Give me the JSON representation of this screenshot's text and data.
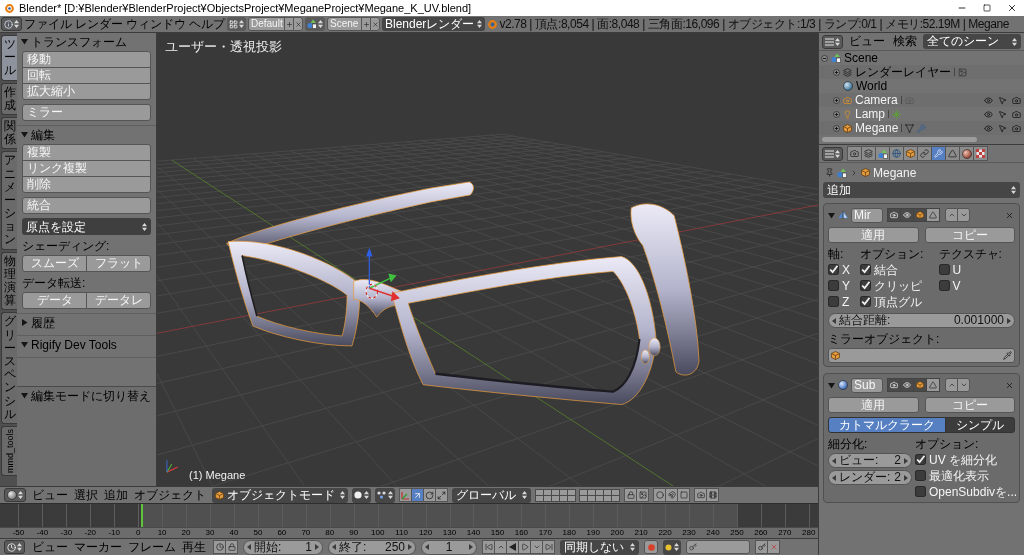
{
  "window": {
    "title": "Blender* [D:¥Blender¥BlenderProject¥ObjectsProject¥MeganeProject¥Megane_K_UV.blend]"
  },
  "info_header": {
    "menus": [
      "ファイル",
      "レンダー",
      "ウィンドウ",
      "ヘルプ"
    ],
    "screen_layout": "Default",
    "scene": "Scene",
    "render_engine": "Blenderレンダー",
    "stats": "v2.78 | 頂点:8,054 | 面:8,048 | 三角面:16,096 | オブジェクト:1/3 | ランプ:0/1 | メモリ:52.19M | Megane"
  },
  "tool_shelf": {
    "tabs": [
      {
        "label": "ツール",
        "kind": "stacked",
        "selected": true
      },
      {
        "label": "作成",
        "kind": "stacked",
        "selected": false
      },
      {
        "label": "関係",
        "kind": "stacked",
        "selected": false
      },
      {
        "label": "アニメーション",
        "kind": "stacked",
        "selected": false
      },
      {
        "label": "物理演算",
        "kind": "stacked",
        "selected": false
      },
      {
        "label": "グリースペンシル",
        "kind": "stacked",
        "selected": false
      },
      {
        "label": "mmd_tools",
        "kind": "rotated",
        "selected": false
      }
    ],
    "panels": [
      {
        "title": "トランスフォーム",
        "expanded": true,
        "rows": [
          {
            "kind": "stack",
            "buttons": [
              "移動",
              "回転",
              "拡大縮小"
            ]
          },
          {
            "kind": "stack",
            "buttons": [
              "ミラー"
            ]
          }
        ]
      },
      {
        "title": "編集",
        "expanded": true,
        "rows": [
          {
            "kind": "stack",
            "buttons": [
              "複製",
              "リンク複製",
              "削除"
            ]
          },
          {
            "kind": "stack",
            "buttons": [
              "統合"
            ]
          },
          {
            "kind": "dropdown",
            "value": "原点を設定"
          },
          {
            "kind": "label",
            "text": "シェーディング:"
          },
          {
            "kind": "pair",
            "buttons": [
              "スムーズ",
              "フラット"
            ]
          },
          {
            "kind": "label",
            "text": "データ転送:"
          },
          {
            "kind": "pair",
            "buttons": [
              "データ",
              "データレ"
            ]
          }
        ]
      },
      {
        "title": "履歴",
        "expanded": false
      },
      {
        "title": "Rigify Dev Tools",
        "expanded": true
      }
    ],
    "last_operator": {
      "title": "編集モードに切り替え",
      "expanded": true
    }
  },
  "viewport": {
    "view_name": "ユーザー・透視投影",
    "object_info": "(1) Megane"
  },
  "viewport_header": {
    "menus": [
      "ビュー",
      "選択",
      "追加",
      "オブジェクト"
    ],
    "mode": "オブジェクトモード",
    "manipulators": [
      {
        "kind": "translate",
        "selected": true
      },
      {
        "kind": "rotate",
        "selected": false
      },
      {
        "kind": "scale",
        "selected": false
      }
    ],
    "orientation": "グローバル"
  },
  "timeline": {
    "ruler": [
      "-50",
      "-40",
      "-30",
      "-20",
      "-10",
      "0",
      "10",
      "20",
      "30",
      "40",
      "50",
      "60",
      "70",
      "80",
      "90",
      "100",
      "110",
      "120",
      "130",
      "140",
      "150",
      "160",
      "170",
      "180",
      "190",
      "200",
      "210",
      "220",
      "230",
      "240",
      "250",
      "260",
      "270",
      "280"
    ]
  },
  "timeline_header": {
    "menus": [
      "ビュー",
      "マーカー",
      "フレーム",
      "再生"
    ],
    "start": {
      "label": "開始:",
      "value": "1"
    },
    "end": {
      "label": "終了:",
      "value": "250"
    },
    "current_frame": "1",
    "sync": "同期しない"
  },
  "outliner": {
    "menus": [
      "ビュー",
      "検索"
    ],
    "display_mode": "全てのシーン",
    "tree": [
      {
        "label": "Scene",
        "kind": "scene",
        "expanded": true,
        "children": [
          {
            "label": "レンダーレイヤー",
            "kind": "render_layers",
            "expanded": false
          },
          {
            "label": "World",
            "kind": "world"
          },
          {
            "label": "Camera",
            "kind": "camera",
            "expanded": false
          },
          {
            "label": "Lamp",
            "kind": "lamp",
            "expanded": false
          },
          {
            "label": "Megane",
            "kind": "mesh",
            "expanded": false
          }
        ]
      }
    ]
  },
  "properties": {
    "tabs": [
      {
        "kind": "render",
        "selected": false
      },
      {
        "kind": "render_layers",
        "selected": false
      },
      {
        "kind": "scene",
        "selected": false
      },
      {
        "kind": "world",
        "selected": false
      },
      {
        "kind": "object",
        "selected": false
      },
      {
        "kind": "constraints",
        "selected": false
      },
      {
        "kind": "modifiers",
        "selected": true
      },
      {
        "kind": "data",
        "selected": false
      },
      {
        "kind": "material",
        "selected": false
      },
      {
        "kind": "texture",
        "selected": false
      }
    ],
    "breadcrumb": "Megane",
    "add_modifier": "追加",
    "modifiers": [
      {
        "kind": "mirror",
        "name": "Mir",
        "expanded": true,
        "toggles": [
          {
            "kind": "render",
            "on": true
          },
          {
            "kind": "viewport",
            "on": true
          },
          {
            "kind": "editmode",
            "on": true
          },
          {
            "kind": "cage",
            "on": false
          }
        ],
        "apply": "適用",
        "copy": "コピー",
        "columns": [
          {
            "title": "軸:",
            "options": [
              {
                "label": "X",
                "checked": true
              },
              {
                "label": "Y",
                "checked": false
              },
              {
                "label": "Z",
                "checked": false
              }
            ]
          },
          {
            "title": "オプション:",
            "options": [
              {
                "label": "結合",
                "checked": true
              },
              {
                "label": "クリッピ",
                "checked": true
              },
              {
                "label": "頂点グル",
                "checked": true
              }
            ]
          },
          {
            "title": "テクスチャ:",
            "options": [
              {
                "label": "U",
                "checked": false
              },
              {
                "label": "V",
                "checked": false
              }
            ]
          }
        ],
        "merge_distance": {
          "label": "結合距離:",
          "value": "0.001000"
        },
        "mirror_object": {
          "label": "ミラーオブジェクト:"
        }
      },
      {
        "kind": "subsurf",
        "name": "Sub",
        "expanded": true,
        "toggles": [
          {
            "kind": "render",
            "on": true
          },
          {
            "kind": "viewport",
            "on": true
          },
          {
            "kind": "editmode",
            "on": true
          },
          {
            "kind": "cage",
            "on": false
          }
        ],
        "apply": "適用",
        "copy": "コピー",
        "algorithms": [
          {
            "label": "カトマルクラーク",
            "selected": true
          },
          {
            "label": "シンプル",
            "selected": false
          }
        ],
        "subdivisions": {
          "title": "細分化:",
          "fields": [
            {
              "label": "ビュー:",
              "value": "2"
            },
            {
              "label": "レンダー:",
              "value": "2"
            }
          ]
        },
        "options": {
          "title": "オプション:",
          "items": [
            {
              "label": "UV を細分化",
              "checked": true
            },
            {
              "label": "最適化表示",
              "checked": false
            },
            {
              "label": "OpenSubdivを...",
              "checked": false
            }
          ]
        }
      }
    ]
  }
}
